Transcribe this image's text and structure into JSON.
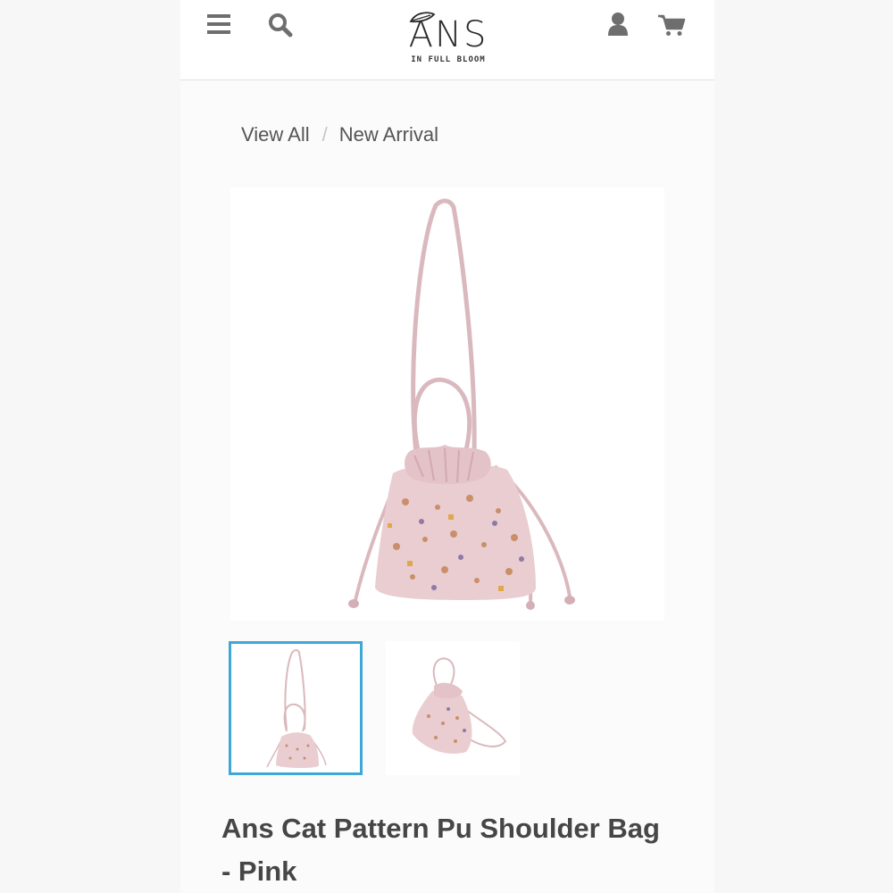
{
  "header": {
    "logo": "ANS",
    "tagline": "IN FULL BLOOM"
  },
  "breadcrumb": {
    "items": [
      "View All",
      "New Arrival"
    ],
    "separator": "/"
  },
  "product": {
    "title": "Ans Cat Pattern Pu Shoulder Bag - Pink",
    "bag_color": "#e9cdd1",
    "strap_color": "#dab9be"
  },
  "gallery": {
    "active_thumb_color": "#3fa7d6"
  }
}
